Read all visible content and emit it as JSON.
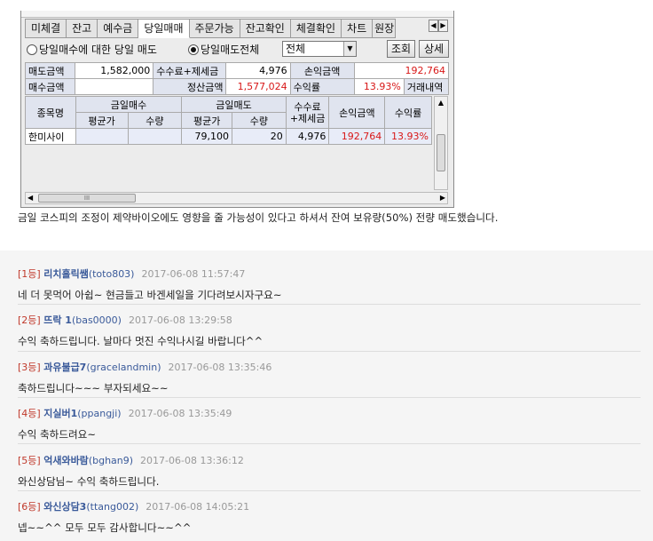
{
  "window": {
    "tabs": [
      "미체결",
      "잔고",
      "예수금",
      "당일매매",
      "주문가능",
      "잔고확인",
      "체결확인",
      "차트",
      "원장"
    ],
    "active_tab": 3,
    "radio_option_1": "당일매수에 대한 당일 매도",
    "radio_option_2": "당일매도전체",
    "select_value": "전체",
    "query_button": "조회",
    "detail_button": "상세",
    "summary": {
      "sell_amount_label": "매도금액",
      "sell_amount_value": "1,582,000",
      "fee_tax_label": "수수료+제세금",
      "fee_tax_value": "4,976",
      "pnl_label": "손익금액",
      "pnl_value": "192,764",
      "buy_amount_label": "매수금액",
      "buy_amount_value": "",
      "settle_label": "정산금액",
      "settle_value": "1,577,024",
      "return_label": "수익률",
      "return_value": "13.93%",
      "history_label": "거래내역"
    },
    "grid": {
      "col_name": "종목명",
      "col_buy_group": "금일매수",
      "col_sell_group": "금일매도",
      "col_avg_price": "평균가",
      "col_qty": "수량",
      "col_fee_line1": "수수료",
      "col_fee_line2": "+제세금",
      "col_pnl": "손익금액",
      "col_return": "수익률",
      "row": {
        "name": "한미사이",
        "buy_avg": "",
        "buy_qty": "",
        "sell_avg": "79,100",
        "sell_qty": "20",
        "fee": "4,976",
        "pnl": "192,764",
        "return": "13.93%"
      }
    },
    "hscroll_thumb": "III"
  },
  "post_caption": "금일 코스피의 조정이 제약바이오에도 영향을 줄 가능성이 있다고 하셔서 잔여 보유량(50%) 전량 매도했습니다.",
  "comments": [
    {
      "rank": "[1등]",
      "nick": "리치홀릭쌤",
      "uid": "(toto803)",
      "date": "2017-06-08 11:57:47",
      "body": "네 더 못먹어 아쉽~ 현금들고 바겐세일을 기다려보시자구요~"
    },
    {
      "rank": "[2등]",
      "nick": "뜨락 1",
      "uid": "(bas0000)",
      "date": "2017-06-08 13:29:58",
      "body": "수익 축하드립니다. 날마다 멋진 수익나시길 바랍니다^^"
    },
    {
      "rank": "[3등]",
      "nick": "과유불급7",
      "uid": "(gracelandmin)",
      "date": "2017-06-08 13:35:46",
      "body": "축하드립니다~~~ 부자되세요~~"
    },
    {
      "rank": "[4등]",
      "nick": "지실버1",
      "uid": "(ppangji)",
      "date": "2017-06-08 13:35:49",
      "body": "수익 축하드려요~"
    },
    {
      "rank": "[5등]",
      "nick": "억새와바람",
      "uid": "(bghan9)",
      "date": "2017-06-08 13:36:12",
      "body": "와신상담님~ 수익 축하드립니다."
    },
    {
      "rank": "[6등]",
      "nick": "와신상담3",
      "uid": "(ttang002)",
      "date": "2017-06-08 14:05:21",
      "body": "넵~~^^ 모두 모두 감사합니다~~^^"
    }
  ]
}
